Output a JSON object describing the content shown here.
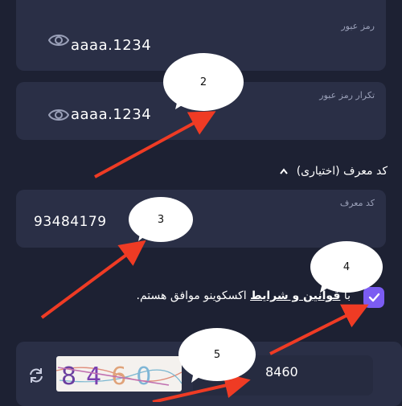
{
  "password": {
    "label": "رمز عبور",
    "value": "aaaa.1234"
  },
  "confirm_password": {
    "label": "تکرار رمز عبور",
    "value": "aaaa.1234"
  },
  "referral": {
    "section_title": "کد معرف (اختیاری)",
    "label": "کد معرف",
    "value": "93484179"
  },
  "terms": {
    "prefix": "با",
    "link": "قوانین و شرایط",
    "suffix": "اکسکوینو موافق هستم.",
    "checked": true
  },
  "captcha": {
    "image_text": "8460",
    "value": "8460"
  },
  "annotations": [
    "2",
    "3",
    "4",
    "5"
  ],
  "colors": {
    "background": "#1d2133",
    "card": "#2a2f46",
    "accent": "#7b5cf2",
    "arrow": "#ef3b24"
  },
  "icons": [
    "eye-icon",
    "chevron-up-icon",
    "check-icon",
    "refresh-icon"
  ]
}
